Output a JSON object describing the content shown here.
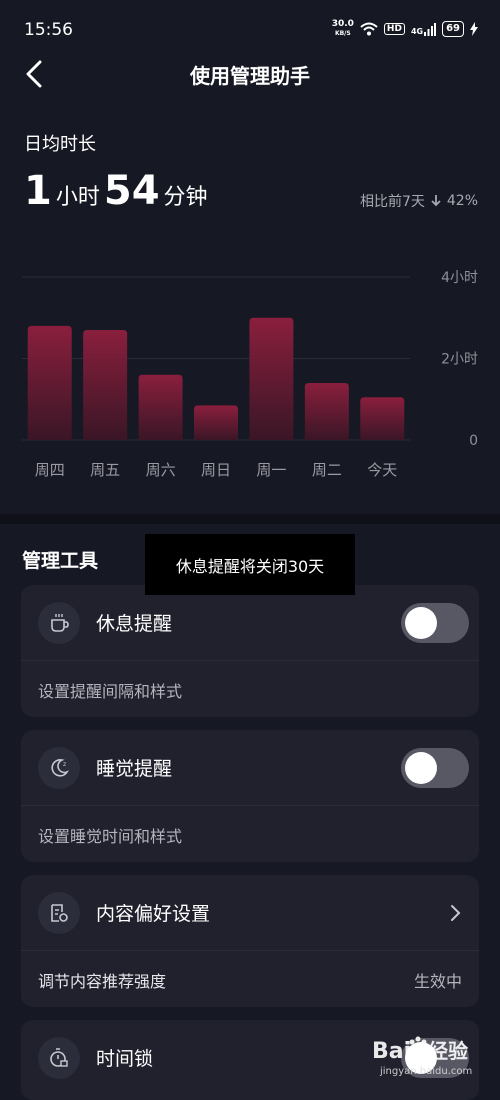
{
  "status_bar": {
    "time": "15:56",
    "net_speed_value": "30.0",
    "net_speed_unit": "KB/S",
    "hd_badge": "HD",
    "signal_label": "4G",
    "battery": "69"
  },
  "nav": {
    "title": "使用管理助手",
    "back_icon": "chevron-left-icon"
  },
  "summary": {
    "label": "日均时长",
    "hours": "1",
    "hours_unit": "小时",
    "minutes": "54",
    "minutes_unit": "分钟",
    "compare_text": "相比前7天",
    "trend_icon": "arrow-down-icon",
    "compare_value": "42%"
  },
  "chart_data": {
    "type": "bar",
    "categories": [
      "周四",
      "周五",
      "周六",
      "周日",
      "周一",
      "周二",
      "今天"
    ],
    "values": [
      2.8,
      2.7,
      1.6,
      0.85,
      3.0,
      1.4,
      1.05
    ],
    "yticks": [
      "4小时",
      "2小时",
      "0"
    ],
    "ylim": [
      0,
      4
    ],
    "colors": {
      "bar_top": "#8a1f3d",
      "bar_bottom": "#3a1626"
    }
  },
  "tools": {
    "section_title": "管理工具",
    "toast": "休息提醒将关闭30天",
    "items": [
      {
        "title": "休息提醒",
        "subtitle": "设置提醒间隔和样式",
        "icon": "cup-icon",
        "control": "toggle",
        "on": false
      },
      {
        "title": "睡觉提醒",
        "subtitle": "设置睡觉时间和样式",
        "icon": "moon-icon",
        "control": "toggle",
        "on": false
      },
      {
        "title": "内容偏好设置",
        "subtitle": "调节内容推荐强度",
        "status": "生效中",
        "icon": "settings-doc-icon",
        "control": "chevron"
      },
      {
        "title": "时间锁",
        "icon": "timer-lock-icon",
        "control": "toggle"
      }
    ]
  },
  "watermark": {
    "brand": "Bai",
    "suffix": "经验",
    "url": "jingyan.baidu.com"
  },
  "colors": {
    "background": "#161823",
    "card": "#20212d",
    "toggle_off": "#575864"
  }
}
